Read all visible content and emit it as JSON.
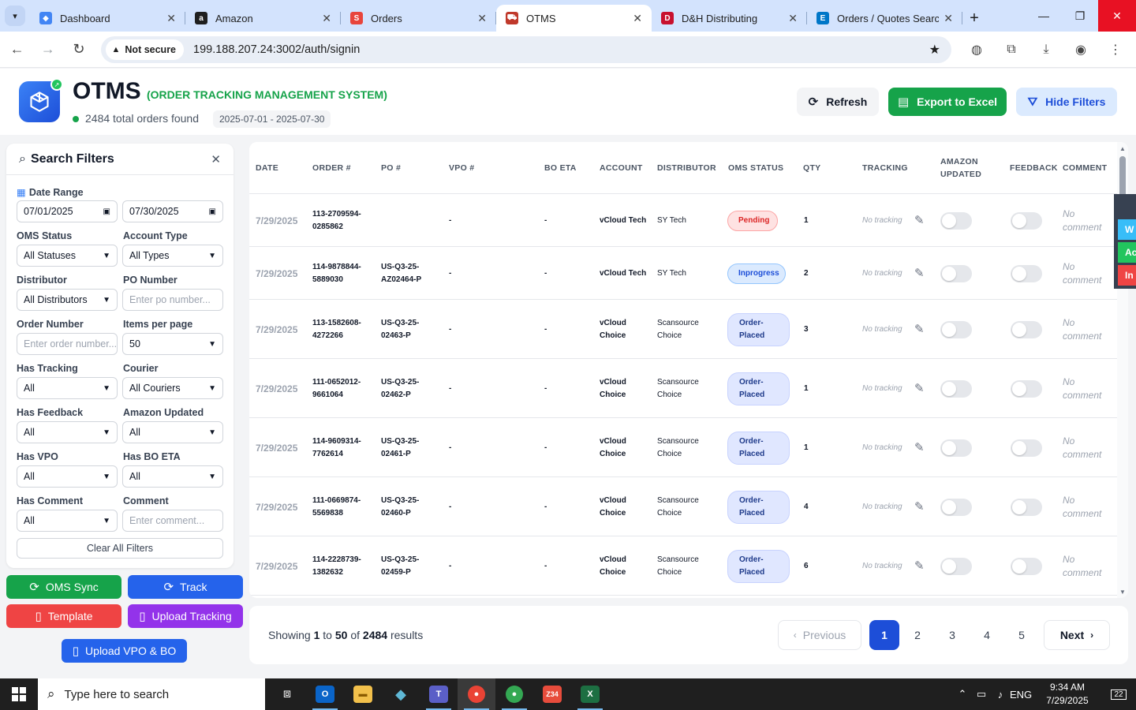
{
  "browser": {
    "tabs": [
      {
        "label": "Dashboard",
        "icon": "dashboard-icon",
        "color": "#4285f4"
      },
      {
        "label": "Amazon",
        "icon": "amazon-icon",
        "color": "#1f1f1f"
      },
      {
        "label": "Orders",
        "icon": "orders-icon",
        "color": "#e8453c"
      },
      {
        "label": "OTMS",
        "icon": "truck-icon",
        "color": "#c0392b",
        "active": true
      },
      {
        "label": "D&H Distributing",
        "icon": "dh-icon",
        "color": "#c8102e"
      },
      {
        "label": "Orders / Quotes Search",
        "icon": "ec-icon",
        "color": "#0077c8"
      }
    ],
    "security_label": "Not secure",
    "url": "199.188.207.24:3002/auth/signin"
  },
  "header": {
    "title": "OTMS",
    "subtitle": "(ORDER TRACKING MANAGEMENT SYSTEM)",
    "total_text": "2484 total orders found",
    "date_range": "2025-07-01 - 2025-07-30",
    "refresh_label": "Refresh",
    "export_label": "Export to Excel",
    "hide_filters_label": "Hide Filters"
  },
  "filters": {
    "title": "Search Filters",
    "date_range_label": "Date Range",
    "date_from": "07/01/2025",
    "date_to": "07/30/2025",
    "oms_status_label": "OMS Status",
    "oms_status_value": "All Statuses",
    "account_type_label": "Account Type",
    "account_type_value": "All Types",
    "distributor_label": "Distributor",
    "distributor_value": "All Distributors",
    "po_number_label": "PO Number",
    "po_number_placeholder": "Enter po number...",
    "order_number_label": "Order Number",
    "order_number_placeholder": "Enter order number...",
    "items_per_page_label": "Items per page",
    "items_per_page_value": "50",
    "has_tracking_label": "Has Tracking",
    "has_tracking_value": "All",
    "courier_label": "Courier",
    "courier_value": "All Couriers",
    "has_feedback_label": "Has Feedback",
    "has_feedback_value": "All",
    "amazon_updated_label": "Amazon Updated",
    "amazon_updated_value": "All",
    "has_vpo_label": "Has VPO",
    "has_vpo_value": "All",
    "has_bo_eta_label": "Has BO ETA",
    "has_bo_eta_value": "All",
    "has_comment_label": "Has Comment",
    "has_comment_value": "All",
    "comment_label": "Comment",
    "comment_placeholder": "Enter comment...",
    "clear_label": "Clear All Filters"
  },
  "actions": {
    "oms_sync": "OMS Sync",
    "track": "Track",
    "template": "Template",
    "upload_tracking": "Upload Tracking",
    "upload_vpo_bo": "Upload VPO & BO"
  },
  "table": {
    "columns": {
      "date": "DATE",
      "order": "ORDER #",
      "po": "PO #",
      "vpo": "VPO #",
      "bo_eta": "BO ETA",
      "account": "ACCOUNT",
      "distributor": "DISTRIBUTOR",
      "oms_status": "OMS STATUS",
      "qty": "QTY",
      "tracking": "TRACKING",
      "amazon_updated_1": "AMAZON",
      "amazon_updated_2": "UPDATED",
      "feedback": "FEEDBACK",
      "comment": "COMMENT"
    },
    "rows": [
      {
        "date": "7/29/2025",
        "order1": "113-2709594-",
        "order2": "0285862",
        "po1": "",
        "po2": "",
        "vpo": "-",
        "bo_eta": "-",
        "account1": "vCloud Tech",
        "account2": "",
        "dist1": "SY Tech",
        "dist2": "",
        "status1": "Pending",
        "status2": "",
        "qty": "1",
        "tracking": "No tracking",
        "comment1": "No",
        "comment2": "comment"
      },
      {
        "date": "7/29/2025",
        "order1": "114-9878844-",
        "order2": "5889030",
        "po1": "US-Q3-25-",
        "po2": "AZ02464-P",
        "vpo": "-",
        "bo_eta": "-",
        "account1": "vCloud Tech",
        "account2": "",
        "dist1": "SY Tech",
        "dist2": "",
        "status1": "Inprogress",
        "status2": "",
        "qty": "2",
        "tracking": "No tracking",
        "comment1": "No",
        "comment2": "comment"
      },
      {
        "date": "7/29/2025",
        "order1": "113-1582608-",
        "order2": "4272266",
        "po1": "US-Q3-25-",
        "po2": "02463-P",
        "vpo": "-",
        "bo_eta": "-",
        "account1": "vCloud",
        "account2": "Choice",
        "dist1": "Scansource",
        "dist2": "Choice",
        "status1": "Order-",
        "status2": "Placed",
        "qty": "3",
        "tracking": "No tracking",
        "comment1": "No",
        "comment2": "comment"
      },
      {
        "date": "7/29/2025",
        "order1": "111-0652012-",
        "order2": "9661064",
        "po1": "US-Q3-25-",
        "po2": "02462-P",
        "vpo": "-",
        "bo_eta": "-",
        "account1": "vCloud",
        "account2": "Choice",
        "dist1": "Scansource",
        "dist2": "Choice",
        "status1": "Order-",
        "status2": "Placed",
        "qty": "1",
        "tracking": "No tracking",
        "comment1": "No",
        "comment2": "comment"
      },
      {
        "date": "7/29/2025",
        "order1": "114-9609314-",
        "order2": "7762614",
        "po1": "US-Q3-25-",
        "po2": "02461-P",
        "vpo": "-",
        "bo_eta": "-",
        "account1": "vCloud",
        "account2": "Choice",
        "dist1": "Scansource",
        "dist2": "Choice",
        "status1": "Order-",
        "status2": "Placed",
        "qty": "1",
        "tracking": "No tracking",
        "comment1": "No",
        "comment2": "comment"
      },
      {
        "date": "7/29/2025",
        "order1": "111-0669874-",
        "order2": "5569838",
        "po1": "US-Q3-25-",
        "po2": "02460-P",
        "vpo": "-",
        "bo_eta": "-",
        "account1": "vCloud",
        "account2": "Choice",
        "dist1": "Scansource",
        "dist2": "Choice",
        "status1": "Order-",
        "status2": "Placed",
        "qty": "4",
        "tracking": "No tracking",
        "comment1": "No",
        "comment2": "comment"
      },
      {
        "date": "7/29/2025",
        "order1": "114-2228739-",
        "order2": "1382632",
        "po1": "US-Q3-25-",
        "po2": "02459-P",
        "vpo": "-",
        "bo_eta": "-",
        "account1": "vCloud",
        "account2": "Choice",
        "dist1": "Scansource",
        "dist2": "Choice",
        "status1": "Order-",
        "status2": "Placed",
        "qty": "6",
        "tracking": "No tracking",
        "comment1": "No",
        "comment2": "comment"
      }
    ]
  },
  "side_peek": [
    "W",
    "Ac",
    "In"
  ],
  "pagination": {
    "showing_prefix": "Showing",
    "from": "1",
    "to_word": "to",
    "to": "50",
    "of_word": "of",
    "total": "2484",
    "results_word": "results",
    "previous": "Previous",
    "next": "Next",
    "pages": [
      "1",
      "2",
      "3",
      "4",
      "5"
    ],
    "current": "1"
  },
  "taskbar": {
    "search_placeholder": "Type here to search",
    "time": "9:34 AM",
    "date": "7/29/2025",
    "notification_count": "22",
    "zoom_badge": "34"
  }
}
